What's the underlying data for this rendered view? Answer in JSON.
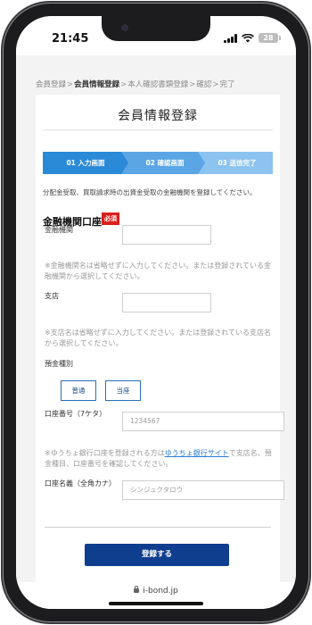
{
  "status_bar": {
    "time": "21:45",
    "battery": "28"
  },
  "breadcrumb": {
    "items": [
      "会員登録",
      "会員情報登録",
      "本人確認書類登録",
      "確認",
      "完了"
    ],
    "separator": ">"
  },
  "page": {
    "title": "会員情報登録"
  },
  "steps": [
    "01 入力画面",
    "02 確認画面",
    "03 送信完了"
  ],
  "intro": "分配金受取、買取請求時の出資金受取の金融機関を登録してください。",
  "section": {
    "title": "金融機関口座",
    "badge": "必須"
  },
  "bank": {
    "label": "金融機関",
    "value": "",
    "note": "※金融機関名は省略せずに入力してください。または登録されている金融機関から選択してください。"
  },
  "branch": {
    "label": "支店",
    "value": "",
    "note": "※支店名は省略せずに入力してください。または登録されている支店名から選択してください。"
  },
  "deposit_type": {
    "label": "預金種別",
    "options": [
      "普通",
      "当座"
    ]
  },
  "account_number": {
    "label": "口座番号（7ケタ）",
    "placeholder": "1234567"
  },
  "yucho_note": {
    "prefix": "※ゆうちょ銀行口座を登録される方は",
    "link": "ゆうちょ銀行サイト",
    "suffix": "で支店名、預金種目、口座番号を確認してください。"
  },
  "account_name": {
    "label": "口座名義（全角カナ）",
    "placeholder": "シンジュクタロウ"
  },
  "submit_label": "登録する",
  "address_bar": {
    "domain": "i-bond.jp"
  },
  "colors": {
    "step_active": "#2b8ad8",
    "submit": "#0f3e8f",
    "required": "#d9201d",
    "link": "#2b7bd3"
  }
}
